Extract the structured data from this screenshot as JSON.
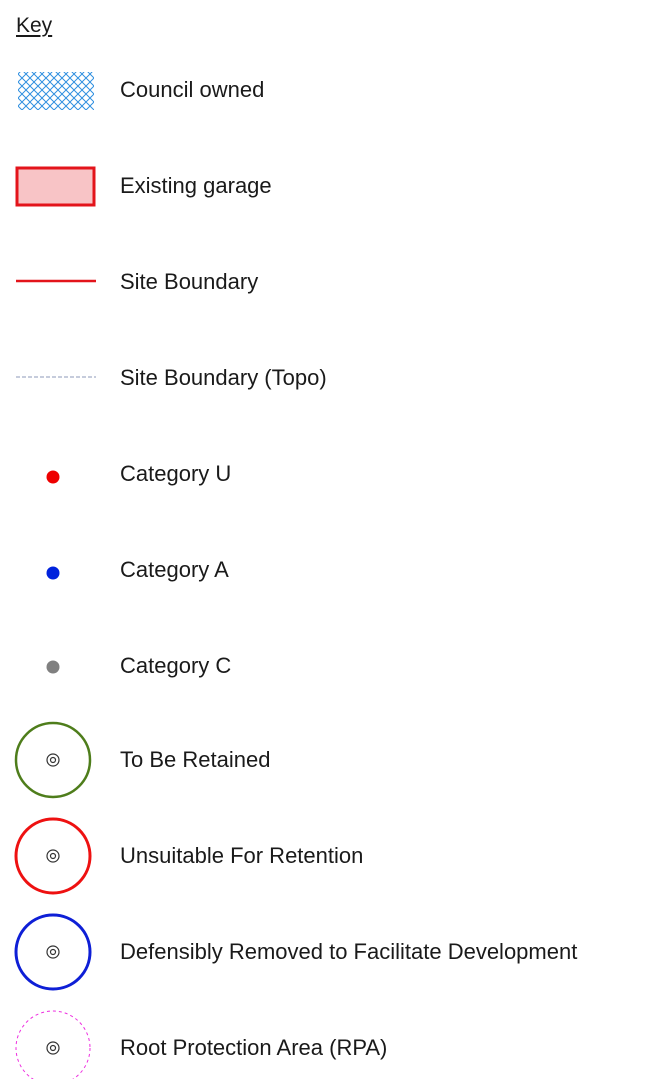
{
  "key": {
    "title": "Key",
    "items": [
      {
        "label": "Council owned",
        "icon": "crosshatch-swatch-icon",
        "color": "#2f8fe0"
      },
      {
        "label": "Existing garage",
        "icon": "garage-swatch-icon",
        "fill": "#f8c4c6",
        "stroke": "#e3141b"
      },
      {
        "label": "Site Boundary",
        "icon": "solid-line-icon",
        "color": "#e3141b"
      },
      {
        "label": "Site Boundary (Topo)",
        "icon": "dashed-line-icon",
        "color": "#8e98b8"
      },
      {
        "label": "Category U",
        "icon": "red-dot-icon",
        "color": "#ee0000"
      },
      {
        "label": "Category A",
        "icon": "blue-dot-icon",
        "color": "#0022dd"
      },
      {
        "label": "Category C",
        "icon": "grey-dot-icon",
        "color": "#808080"
      },
      {
        "label": "To Be Retained",
        "icon": "green-circle-icon",
        "color": "#4e7d1b"
      },
      {
        "label": "Unsuitable For Retention",
        "icon": "red-circle-icon",
        "color": "#ee1111"
      },
      {
        "label": "Defensibly Removed to Facilitate Development",
        "icon": "blue-circle-icon",
        "color": "#0e1fd6"
      },
      {
        "label": "Root Protection Area (RPA)",
        "icon": "magenta-dashed-circle-icon",
        "color": "#ee2ee0"
      }
    ]
  }
}
